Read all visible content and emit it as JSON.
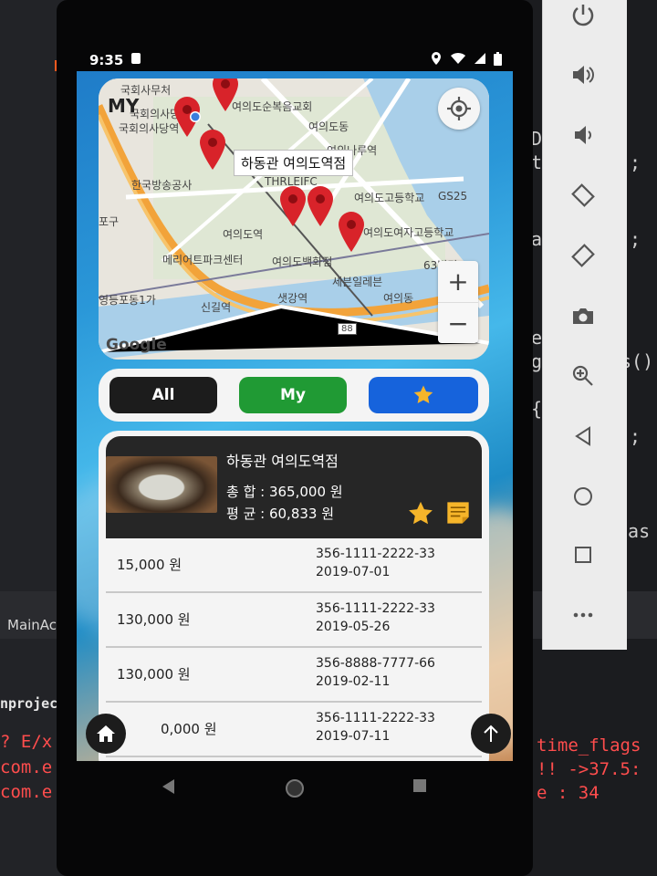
{
  "status_bar": {
    "time": "9:35"
  },
  "map": {
    "my_label": "MY",
    "popup_title": "하동관 여의도역점",
    "labels": [
      "국회사무처",
      "국회의사당역",
      "국회의사당",
      "여의도순복음교회",
      "여의도동",
      "여의나루역",
      "한국방송공사",
      "THRLEIFC",
      "여의도고등학교",
      "GS25",
      "여의도역",
      "여의도여자고등학교",
      "메리어트파크센터",
      "여의도백화점",
      "세븐일레븐",
      "63빌딩",
      "샛강역",
      "신길역",
      "영등포동1가",
      "88",
      "포구",
      "여의동"
    ],
    "zoom_in": "+",
    "zoom_out": "−",
    "attribution": "Google"
  },
  "filters": {
    "all": "All",
    "my": "My"
  },
  "store": {
    "name": "하동관 여의도역점",
    "total": "총 합 : 365,000 원",
    "average": "평 균 : 60,833 원"
  },
  "transactions": [
    {
      "amount": "15,000 원",
      "account": "356-1111-2222-33",
      "date": "2019-07-01"
    },
    {
      "amount": "130,000 원",
      "account": "356-1111-2222-33",
      "date": "2019-05-26"
    },
    {
      "amount": "130,000 원",
      "account": "356-8888-7777-66",
      "date": "2019-02-11"
    },
    {
      "amount": "0,000 원",
      "account": "356-1111-2222-33",
      "date": "2019-07-11"
    }
  ],
  "background": {
    "tab": "MainAc",
    "project": "nprojec",
    "errors": [
      "? E/x",
      "com.e",
      "com.e"
    ],
    "right_errors": [
      "time_flags",
      "!! ->37.5:",
      "e : 34"
    ],
    "code_right": [
      "D",
      "t",
      ";",
      "a",
      ";",
      "e",
      "g",
      "s()",
      "{",
      ";",
      "bas"
    ]
  },
  "colors": {
    "all": "#1c1c1c",
    "my": "#209a34",
    "favorites": "#1663dc",
    "marker": "#d8232a"
  }
}
